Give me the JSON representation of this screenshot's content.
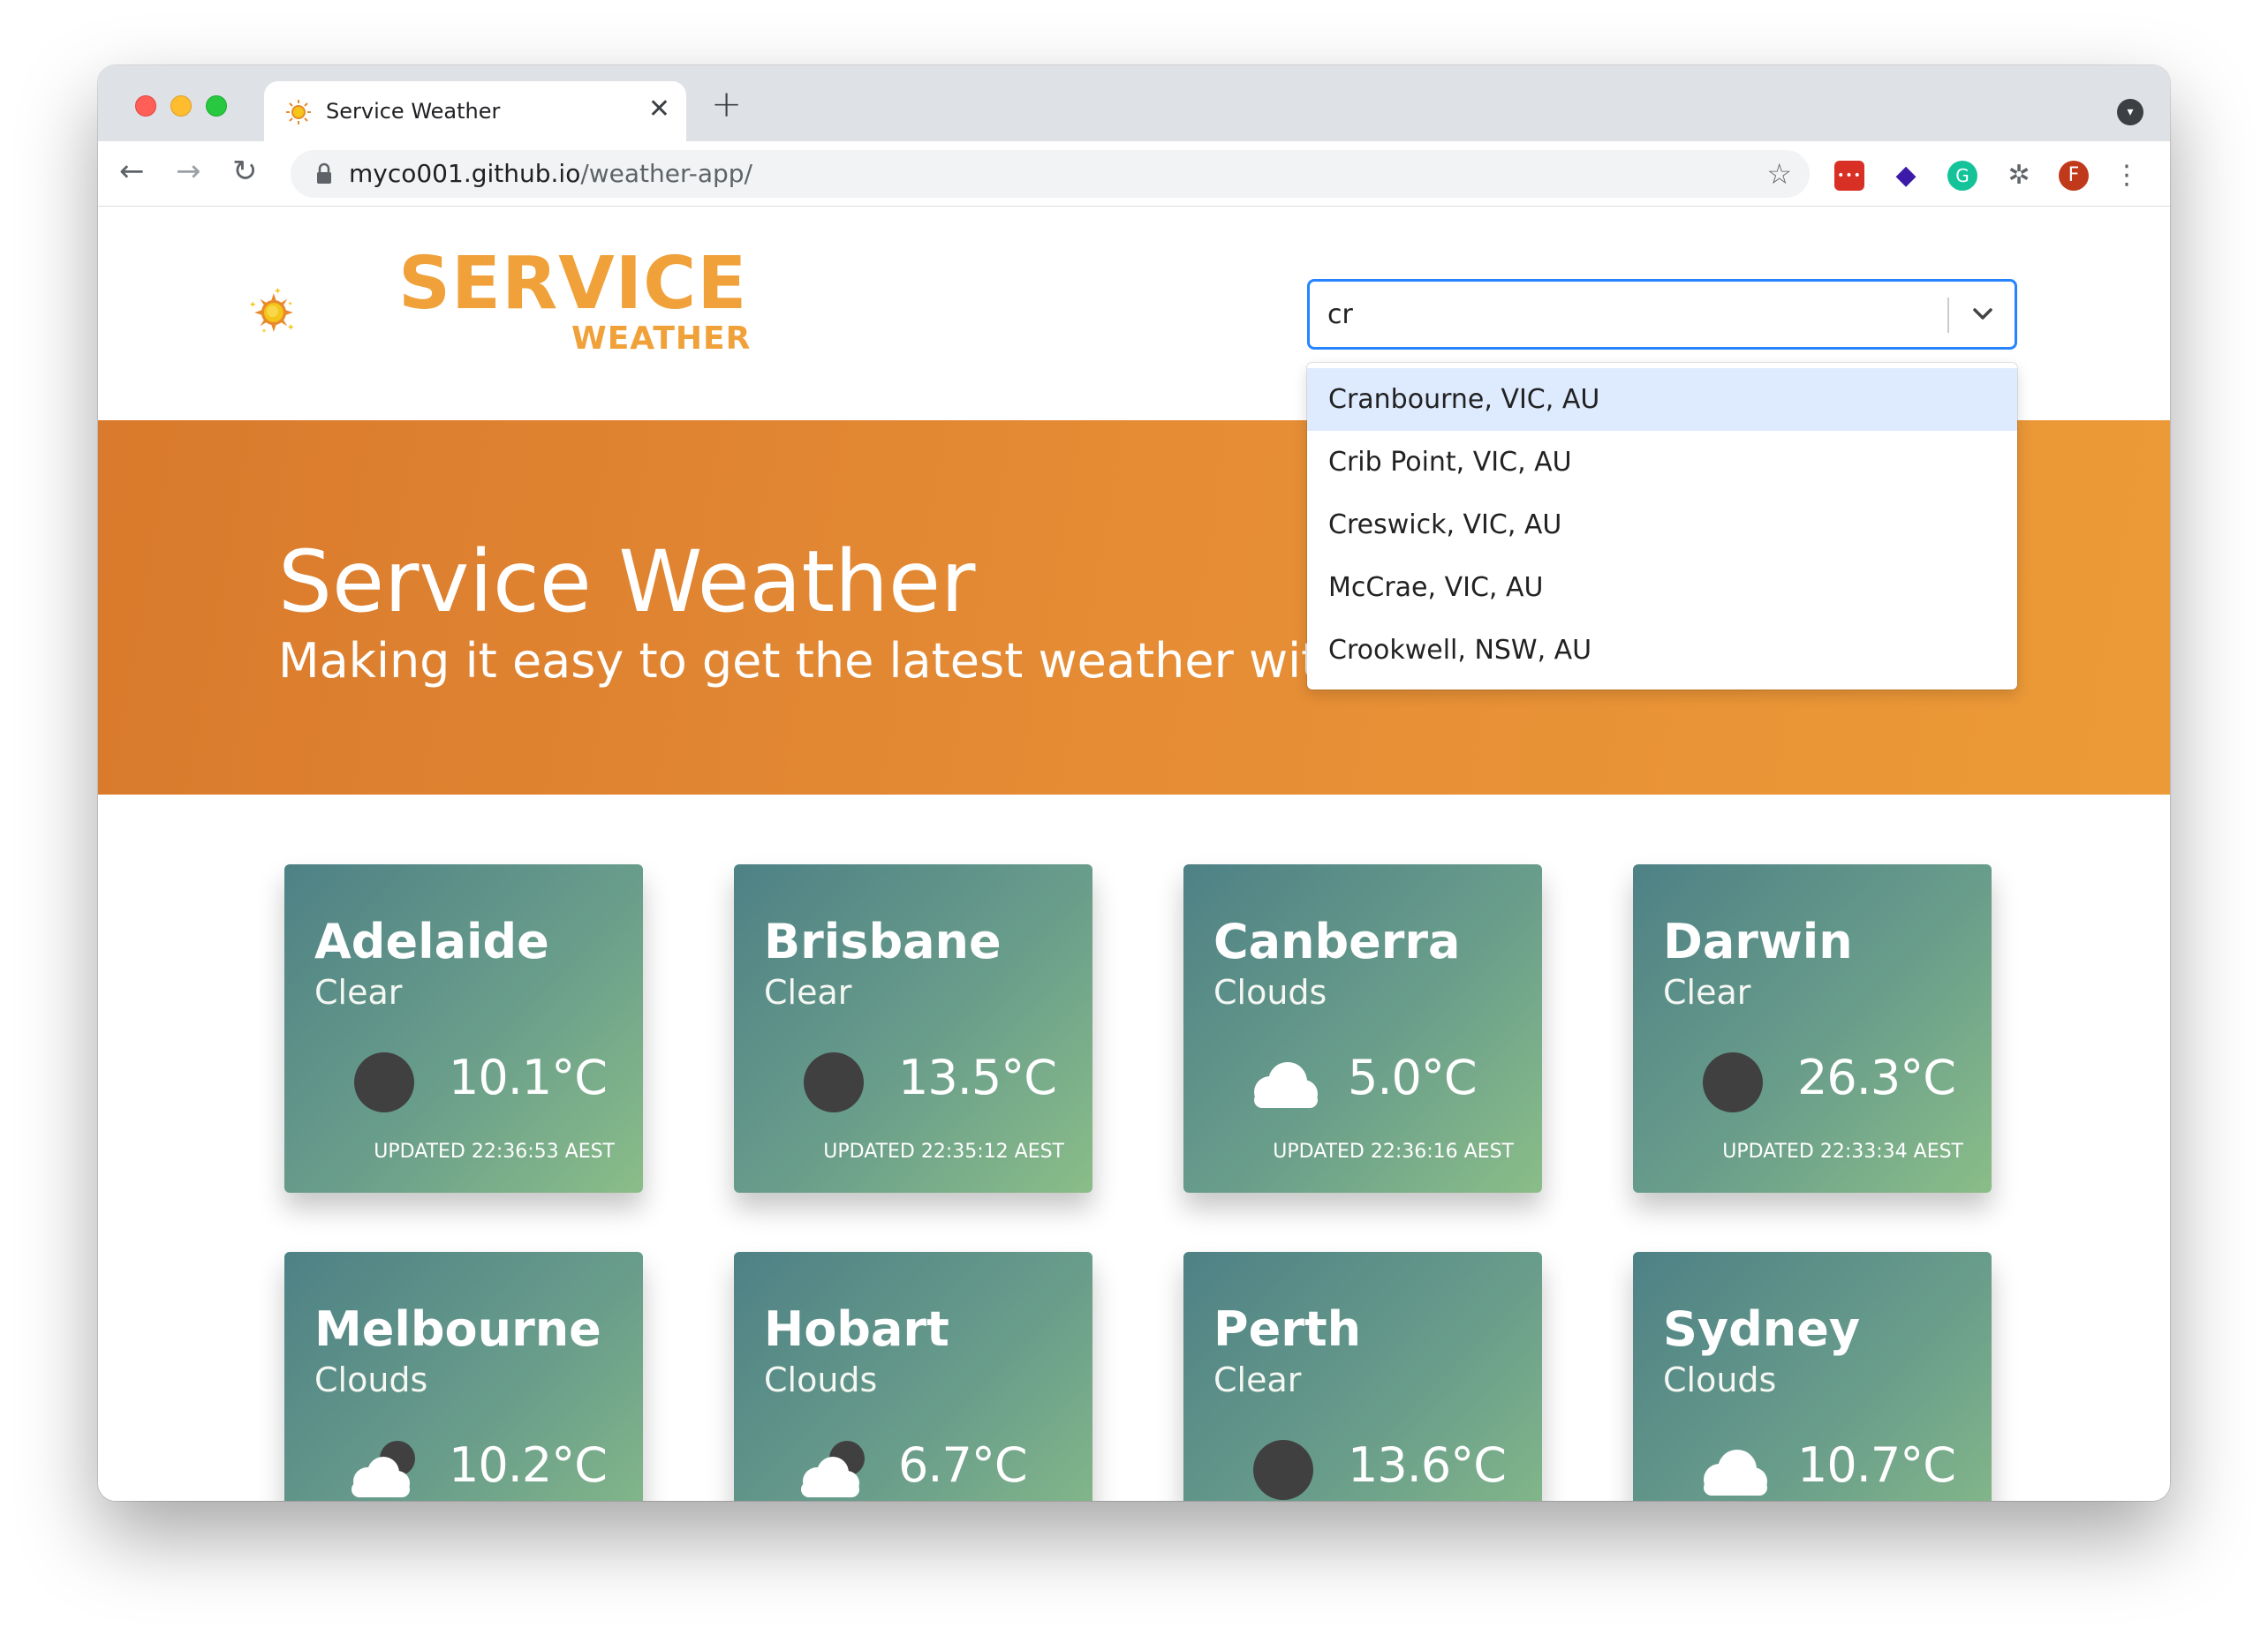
{
  "browser": {
    "tab_title": "Service Weather",
    "tab_close": "✕",
    "new_tab": "+",
    "url_host": "myco001.github.io",
    "url_path": "/weather-app/",
    "profile_initial": "F",
    "ext_badge": "•••",
    "ext_grammarly": "G"
  },
  "header": {
    "logo_word1": "SERVICE",
    "logo_word2": "WEATHER",
    "search_value": "cr",
    "options": [
      "Cranbourne, VIC, AU",
      "Crib Point, VIC, AU",
      "Creswick, VIC, AU",
      "McCrae, VIC, AU",
      "Crookwell, NSW, AU"
    ]
  },
  "hero": {
    "title": "Service Weather",
    "subtitle": "Making it easy to get the latest weather within A"
  },
  "colors": {
    "brand_orange": "#f0a13a",
    "hero_start": "#d97a2c",
    "hero_end": "#ec9a37",
    "card_start": "#4e8185",
    "card_end": "#8abd88",
    "focus_blue": "#2684ff"
  },
  "cards": [
    {
      "city": "Adelaide",
      "condition": "Clear",
      "icon": "moon-icon",
      "temp": "10.1°C",
      "updated_label": "UPDATED",
      "updated_time": "22:36:53 AEST"
    },
    {
      "city": "Brisbane",
      "condition": "Clear",
      "icon": "moon-icon",
      "temp": "13.5°C",
      "updated_label": "UPDATED",
      "updated_time": "22:35:12 AEST"
    },
    {
      "city": "Canberra",
      "condition": "Clouds",
      "icon": "cloud-icon",
      "temp": "5.0°C",
      "updated_label": "UPDATED",
      "updated_time": "22:36:16 AEST"
    },
    {
      "city": "Darwin",
      "condition": "Clear",
      "icon": "moon-icon",
      "temp": "26.3°C",
      "updated_label": "UPDATED",
      "updated_time": "22:33:34 AEST"
    },
    {
      "city": "Melbourne",
      "condition": "Clouds",
      "icon": "cloudy-night-icon",
      "temp": "10.2°C",
      "updated_label": "",
      "updated_time": ""
    },
    {
      "city": "Hobart",
      "condition": "Clouds",
      "icon": "cloudy-night-icon",
      "temp": "6.7°C",
      "updated_label": "",
      "updated_time": ""
    },
    {
      "city": "Perth",
      "condition": "Clear",
      "icon": "moon-icon",
      "temp": "13.6°C",
      "updated_label": "",
      "updated_time": ""
    },
    {
      "city": "Sydney",
      "condition": "Clouds",
      "icon": "cloud-icon",
      "temp": "10.7°C",
      "updated_label": "",
      "updated_time": ""
    }
  ]
}
